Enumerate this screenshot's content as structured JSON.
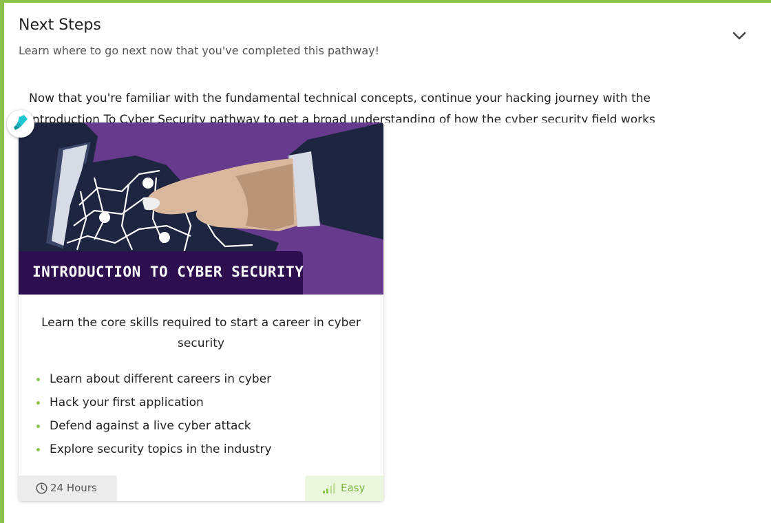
{
  "section": {
    "title": "Next Steps",
    "subtitle": "Learn where to go next now that you've completed this pathway!",
    "intro_line1": "Now that you're familiar with the fundamental technical concepts, continue your hacking journey with the",
    "intro_line2": "Introduction To Cyber Security pathway to get a broad understanding of how the cyber security field works",
    "collapse_icon": "chevron-down-icon",
    "accent_color": "#8bc34a"
  },
  "card": {
    "banner_title": "INTRODUCTION TO CYBER SECURITY",
    "description": "Learn the core skills required to start a career in cyber security",
    "features": [
      "Learn about different careers in cyber",
      "Hack your first application",
      "Defend against a live cyber attack",
      "Explore security topics in the industry"
    ],
    "duration": "24 Hours",
    "difficulty": "Easy",
    "banner_color": "#663a8c",
    "label_color": "#2d0e4e"
  },
  "marker_icon": "highlighter-icon"
}
